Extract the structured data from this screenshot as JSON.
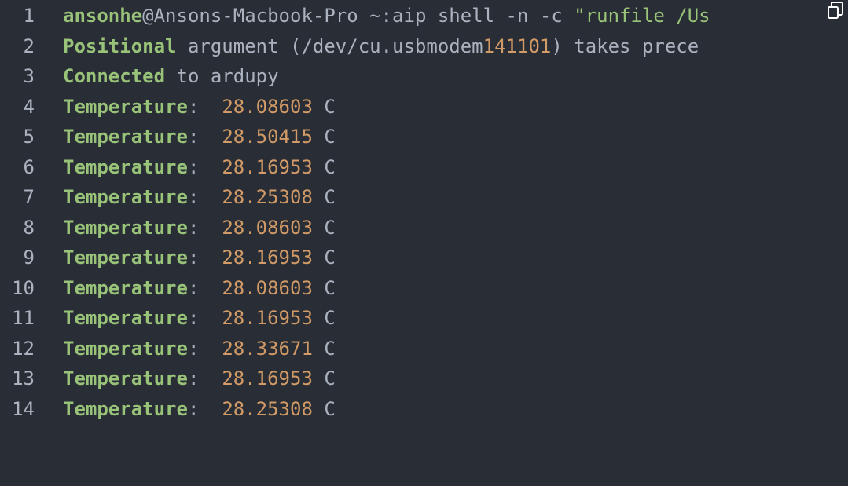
{
  "lines": [
    {
      "n": "1",
      "parts": [
        {
          "t": "ansonhe",
          "c": "kw"
        },
        {
          "t": "@Ansons-Macbook-Pro ~:aip shell -n -c ",
          "c": "plain"
        },
        {
          "t": "\"runfile /Us",
          "c": "str"
        }
      ]
    },
    {
      "n": "2",
      "parts": [
        {
          "t": "Positional",
          "c": "kw"
        },
        {
          "t": " argument (/dev/cu.usbmodem",
          "c": "plain"
        },
        {
          "t": "141101",
          "c": "num"
        },
        {
          "t": ") takes prece",
          "c": "plain"
        }
      ]
    },
    {
      "n": "3",
      "parts": [
        {
          "t": "Connected",
          "c": "kw"
        },
        {
          "t": " to ardupy",
          "c": "plain"
        }
      ]
    },
    {
      "n": "4",
      "parts": [
        {
          "t": "Temperature",
          "c": "kw"
        },
        {
          "t": ":  ",
          "c": "plain"
        },
        {
          "t": "28.08603",
          "c": "num"
        },
        {
          "t": " C",
          "c": "plain"
        }
      ]
    },
    {
      "n": "5",
      "parts": [
        {
          "t": "Temperature",
          "c": "kw"
        },
        {
          "t": ":  ",
          "c": "plain"
        },
        {
          "t": "28.50415",
          "c": "num"
        },
        {
          "t": " C",
          "c": "plain"
        }
      ]
    },
    {
      "n": "6",
      "parts": [
        {
          "t": "Temperature",
          "c": "kw"
        },
        {
          "t": ":  ",
          "c": "plain"
        },
        {
          "t": "28.16953",
          "c": "num"
        },
        {
          "t": " C",
          "c": "plain"
        }
      ]
    },
    {
      "n": "7",
      "parts": [
        {
          "t": "Temperature",
          "c": "kw"
        },
        {
          "t": ":  ",
          "c": "plain"
        },
        {
          "t": "28.25308",
          "c": "num"
        },
        {
          "t": " C",
          "c": "plain"
        }
      ]
    },
    {
      "n": "8",
      "parts": [
        {
          "t": "Temperature",
          "c": "kw"
        },
        {
          "t": ":  ",
          "c": "plain"
        },
        {
          "t": "28.08603",
          "c": "num"
        },
        {
          "t": " C",
          "c": "plain"
        }
      ]
    },
    {
      "n": "9",
      "parts": [
        {
          "t": "Temperature",
          "c": "kw"
        },
        {
          "t": ":  ",
          "c": "plain"
        },
        {
          "t": "28.16953",
          "c": "num"
        },
        {
          "t": " C",
          "c": "plain"
        }
      ]
    },
    {
      "n": "10",
      "parts": [
        {
          "t": "Temperature",
          "c": "kw"
        },
        {
          "t": ":  ",
          "c": "plain"
        },
        {
          "t": "28.08603",
          "c": "num"
        },
        {
          "t": " C",
          "c": "plain"
        }
      ]
    },
    {
      "n": "11",
      "parts": [
        {
          "t": "Temperature",
          "c": "kw"
        },
        {
          "t": ":  ",
          "c": "plain"
        },
        {
          "t": "28.16953",
          "c": "num"
        },
        {
          "t": " C",
          "c": "plain"
        }
      ]
    },
    {
      "n": "12",
      "parts": [
        {
          "t": "Temperature",
          "c": "kw"
        },
        {
          "t": ":  ",
          "c": "plain"
        },
        {
          "t": "28.33671",
          "c": "num"
        },
        {
          "t": " C",
          "c": "plain"
        }
      ]
    },
    {
      "n": "13",
      "parts": [
        {
          "t": "Temperature",
          "c": "kw"
        },
        {
          "t": ":  ",
          "c": "plain"
        },
        {
          "t": "28.16953",
          "c": "num"
        },
        {
          "t": " C",
          "c": "plain"
        }
      ]
    },
    {
      "n": "14",
      "parts": [
        {
          "t": "Temperature",
          "c": "kw"
        },
        {
          "t": ":  ",
          "c": "plain"
        },
        {
          "t": "28.25308",
          "c": "num"
        },
        {
          "t": " C",
          "c": "plain"
        }
      ]
    }
  ],
  "colors": {
    "background": "#292d35",
    "text": "#abb2bf",
    "keyword": "#98c379",
    "number": "#d19a66"
  },
  "icons": {
    "copy": "copy-icon"
  }
}
